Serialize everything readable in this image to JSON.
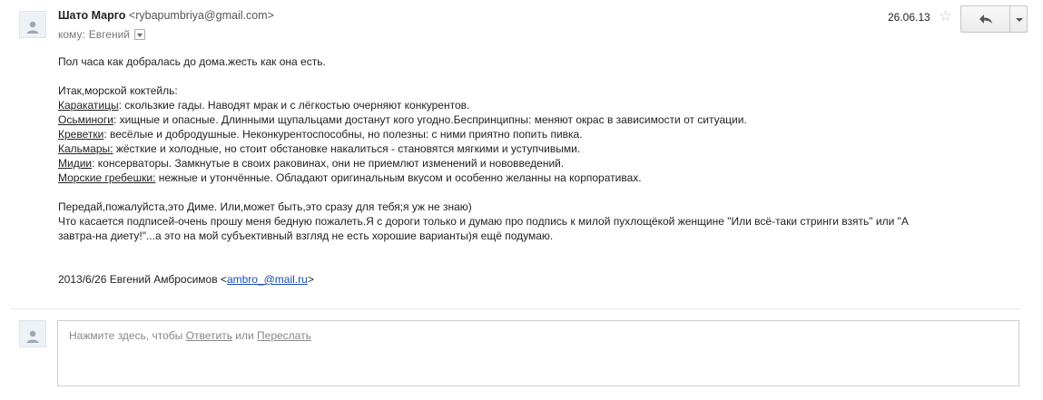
{
  "message": {
    "sender_name": "Шато Марго",
    "sender_email": "<rybapumbriya@gmail.com>",
    "to_label": "кому:",
    "recipient": "Евгений",
    "date": "26.06.13",
    "star_icon": "☆",
    "body": {
      "line1": "Пол часа как добралась до дома.жесть как она есть.",
      "intro": "Итак,морской коктейль:",
      "items": [
        {
          "term": "Каракатицы",
          "desc": ": скользкие гады. Наводят мрак и с лёгкостью очерняют конкурентов."
        },
        {
          "term": "Осьминоги",
          "desc": ": хищные и опасные. Длинными щупальцами достанут кого угодно.Беспринципны: меняют окрас в зависимости от ситуации."
        },
        {
          "term": "Креветки",
          "desc": ": весёлые и добродушные. Неконкурентоспособны, но полезны: с ними приятно попить пивка."
        },
        {
          "term": "Кальмары:",
          "desc": " жёсткие и холодные, но стоит обстановке накалиться - становятся мягкими и уступчивыми."
        },
        {
          "term": "Мидии",
          "desc": ": консерваторы. Замкнутые в своих раковинах, они не приемлют изменений и нововведений."
        },
        {
          "term": "Морские гребешки:",
          "desc": " нежные и утончённые. Обладают оригинальным вкусом и особенно желанны на корпоративах."
        }
      ],
      "para2": "Передай,пожалуйста,это Диме. Или,может быть,это сразу для тебя;я уж не знаю)",
      "para3_line1": "Что касается подписей-очень прошу меня бедную пожалеть.Я с дороги только и думаю про подпись к милой пухлощёкой женщине \"Или всё-таки стринги взять\" или \"А",
      "para3_line2": "завтра-на диету!\"...а это на мой субъективный взгляд не есть хорошие варианты)я ещё подумаю.",
      "quote_prefix": "2013/6/26 Евгений Амбросимов <",
      "quote_email": "ambro_@mail.ru",
      "quote_suffix": ">"
    }
  },
  "reply": {
    "prompt_before": "Нажмите здесь, чтобы ",
    "reply_link": "Ответить",
    "or_text": " или ",
    "forward_link": "Переслать"
  }
}
